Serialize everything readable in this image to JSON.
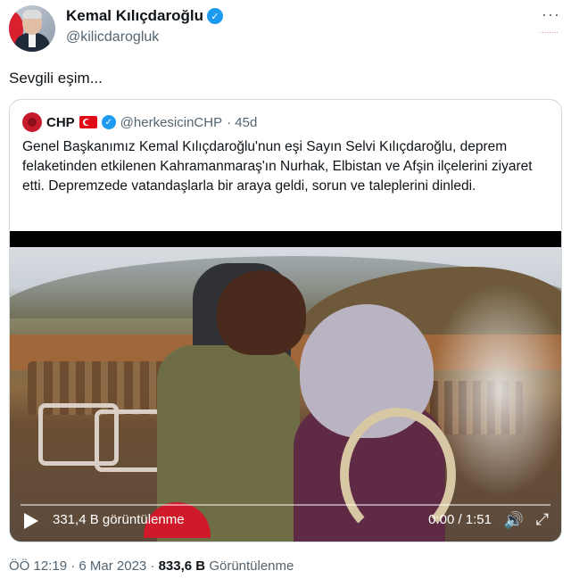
{
  "tweet": {
    "author_name": "Kemal Kılıçdaroğlu",
    "author_handle": "@kilicdarogluk",
    "more_label": "···",
    "corner_mark": "········",
    "text": "Sevgili eşim...",
    "verified_glyph": "✓"
  },
  "quote": {
    "name": "CHP",
    "handle": "@herkesicinCHP",
    "age": "· 45d",
    "body": "Genel Başkanımız Kemal Kılıçdaroğlu'nun eşi Sayın Selvi Kılıçdaroğlu, deprem felaketinden etkilenen Kahramanmaraş'ın Nurhak, Elbistan ve Afşin ilçelerini ziyaret etti. Depremzede vatandaşlarla bir araya geldi, sorun ve taleplerini dinledi.",
    "verified_glyph": "✓"
  },
  "video": {
    "views": "331,4 B görüntülenme",
    "time": "0:00 / 1:51",
    "volume_glyph": "🔊",
    "fullscreen_glyph": "⤢"
  },
  "footer": {
    "time_date": "ÖÖ 12:19 · 6 Mar 2023 ·",
    "views_count": "833,6 B",
    "views_label": "Görüntülenme"
  }
}
